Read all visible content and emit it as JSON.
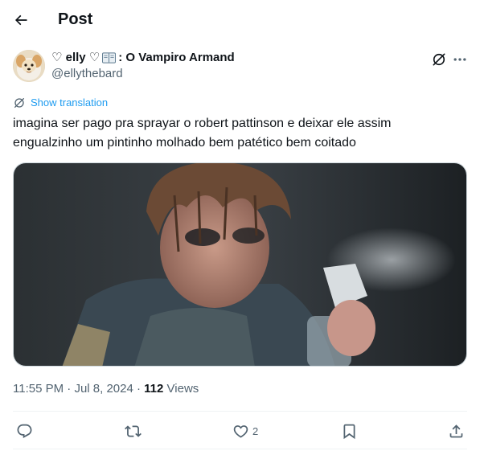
{
  "header": {
    "title": "Post"
  },
  "author": {
    "name_prefix": "♡ elly ♡",
    "name_suffix": ": O Vampiro Armand",
    "handle": "@ellythebard"
  },
  "translate": {
    "label": "Show translation"
  },
  "tweet": {
    "lines": [
      "imagina ser pago pra sprayar o robert pattinson e deixar ele assim",
      "engualzinho um pintinho molhado bem patético bem coitado"
    ]
  },
  "meta": {
    "time": "11:55 PM",
    "separator": " · ",
    "date": "Jul 8, 2024",
    "views_count": "112",
    "views_label": " Views"
  },
  "actions": {
    "reply_count": "",
    "repost_count": "",
    "like_count": "2",
    "bookmark_count": ""
  },
  "colors": {
    "text": "#0f1419",
    "secondary": "#536471",
    "accent": "#1d9bf0",
    "divider": "#eff3f4"
  },
  "icons": [
    "back-arrow-icon",
    "book-icon",
    "grok-icon",
    "more-icon",
    "translate-icon",
    "reply-icon",
    "repost-icon",
    "like-icon",
    "bookmark-icon",
    "share-icon"
  ]
}
